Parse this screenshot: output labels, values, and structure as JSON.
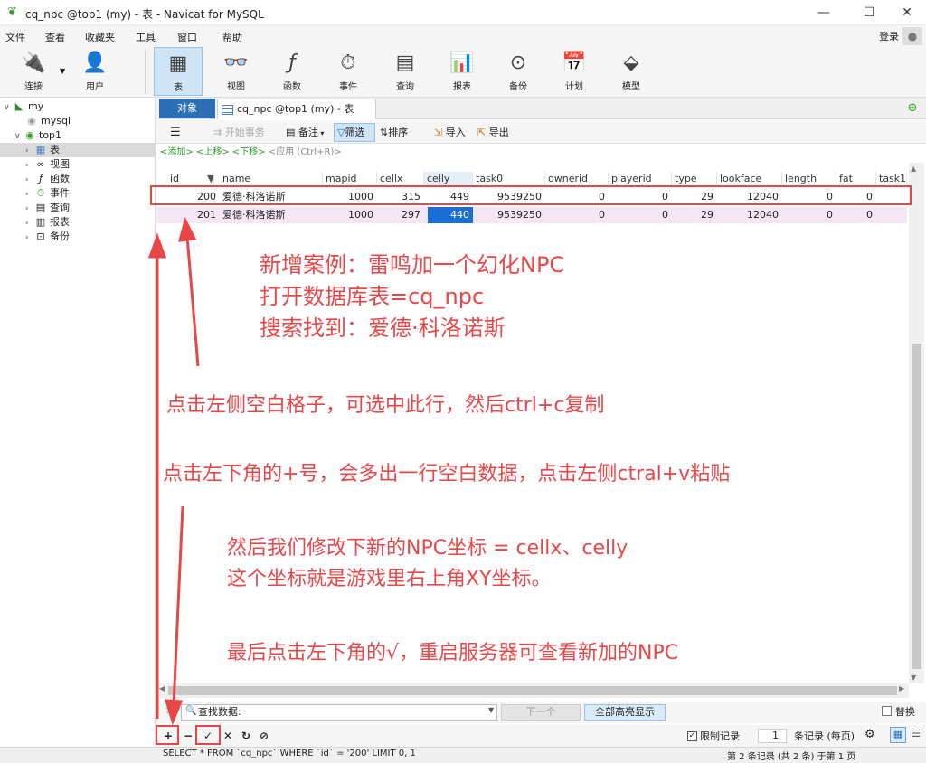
{
  "window": {
    "title": "cq_npc @top1 (my) - 表 - Navicat for MySQL",
    "minimize": "—",
    "maximize": "☐",
    "close": "✕"
  },
  "menu": [
    "文件",
    "查看",
    "收藏夹",
    "工具",
    "窗口",
    "帮助"
  ],
  "login": "登录",
  "toolbar": [
    {
      "label": "连接",
      "icon": "plug-icon"
    },
    {
      "label": "用户",
      "icon": "user-icon"
    },
    {
      "label": "表",
      "icon": "table-icon"
    },
    {
      "label": "视图",
      "icon": "view-icon"
    },
    {
      "label": "函数",
      "icon": "function-icon"
    },
    {
      "label": "事件",
      "icon": "event-icon"
    },
    {
      "label": "查询",
      "icon": "query-icon"
    },
    {
      "label": "报表",
      "icon": "report-icon"
    },
    {
      "label": "备份",
      "icon": "backup-icon"
    },
    {
      "label": "计划",
      "icon": "schedule-icon"
    },
    {
      "label": "模型",
      "icon": "model-icon"
    }
  ],
  "sidebar": {
    "root": "my",
    "dbs": [
      "mysql",
      "top1"
    ],
    "items": [
      "表",
      "视图",
      "函数",
      "事件",
      "查询",
      "报表",
      "备份"
    ]
  },
  "tabs": {
    "objects": "对象",
    "table": "cq_npc @top1 (my) - 表"
  },
  "subtoolbar": {
    "menu": "☰",
    "begin": "开始事务",
    "note": "备注",
    "filter": "筛选",
    "sort": "排序",
    "import": "导入",
    "export": "导出"
  },
  "hint": {
    "add": "<添加>",
    "up": "<上移>",
    "down": "<下移>",
    "apply": "<应用 (Ctrl+R)>"
  },
  "columns": [
    "id",
    "name",
    "mapid",
    "cellx",
    "celly",
    "task0",
    "ownerid",
    "playerid",
    "type",
    "lookface",
    "length",
    "fat",
    "task1"
  ],
  "rows": [
    [
      "200",
      "爱德·科洛诺斯",
      "1000",
      "315",
      "449",
      "9539250",
      "0",
      "0",
      "29",
      "12040",
      "0",
      "0"
    ],
    [
      "201",
      "爱德·科洛诺斯",
      "1000",
      "297",
      "440",
      "9539250",
      "0",
      "0",
      "29",
      "12040",
      "0",
      "0"
    ]
  ],
  "search": {
    "placeholder": "查找数据:",
    "next": "下一个",
    "highlight_all": "全部高亮显示",
    "replace": "替换"
  },
  "bottom": {
    "limit_label": "限制记录",
    "limit_value": "1",
    "limit_unit": "条记录 (每页)"
  },
  "status": {
    "sql": "SELECT * FROM `cq_npc` WHERE `id` = '200' LIMIT 0, 1",
    "records": "第 2 条记录 (共 2 条) 于第 1 页"
  },
  "annotations": {
    "a1": "新增案例：雷鸣加一个幻化NPC",
    "a2": "打开数据库表=cq_npc",
    "a3": "搜索找到：爱德·科洛诺斯",
    "a4": "点击左侧空白格子，可选中此行，然后ctrl+c复制",
    "a5": "点击左下角的+号，会多出一行空白数据，点击左侧ctral+v粘贴",
    "a6": "然后我们修改下新的NPC坐标 = cellx、celly",
    "a7": "这个坐标就是游戏里右上角XY坐标。",
    "a8": "最后点击左下角的√，重启服务器可查看新加的NPC"
  },
  "colors": {
    "annotation": "#e8474a",
    "accent": "#2d6fb4",
    "selected_cell": "#1a6fd6"
  }
}
